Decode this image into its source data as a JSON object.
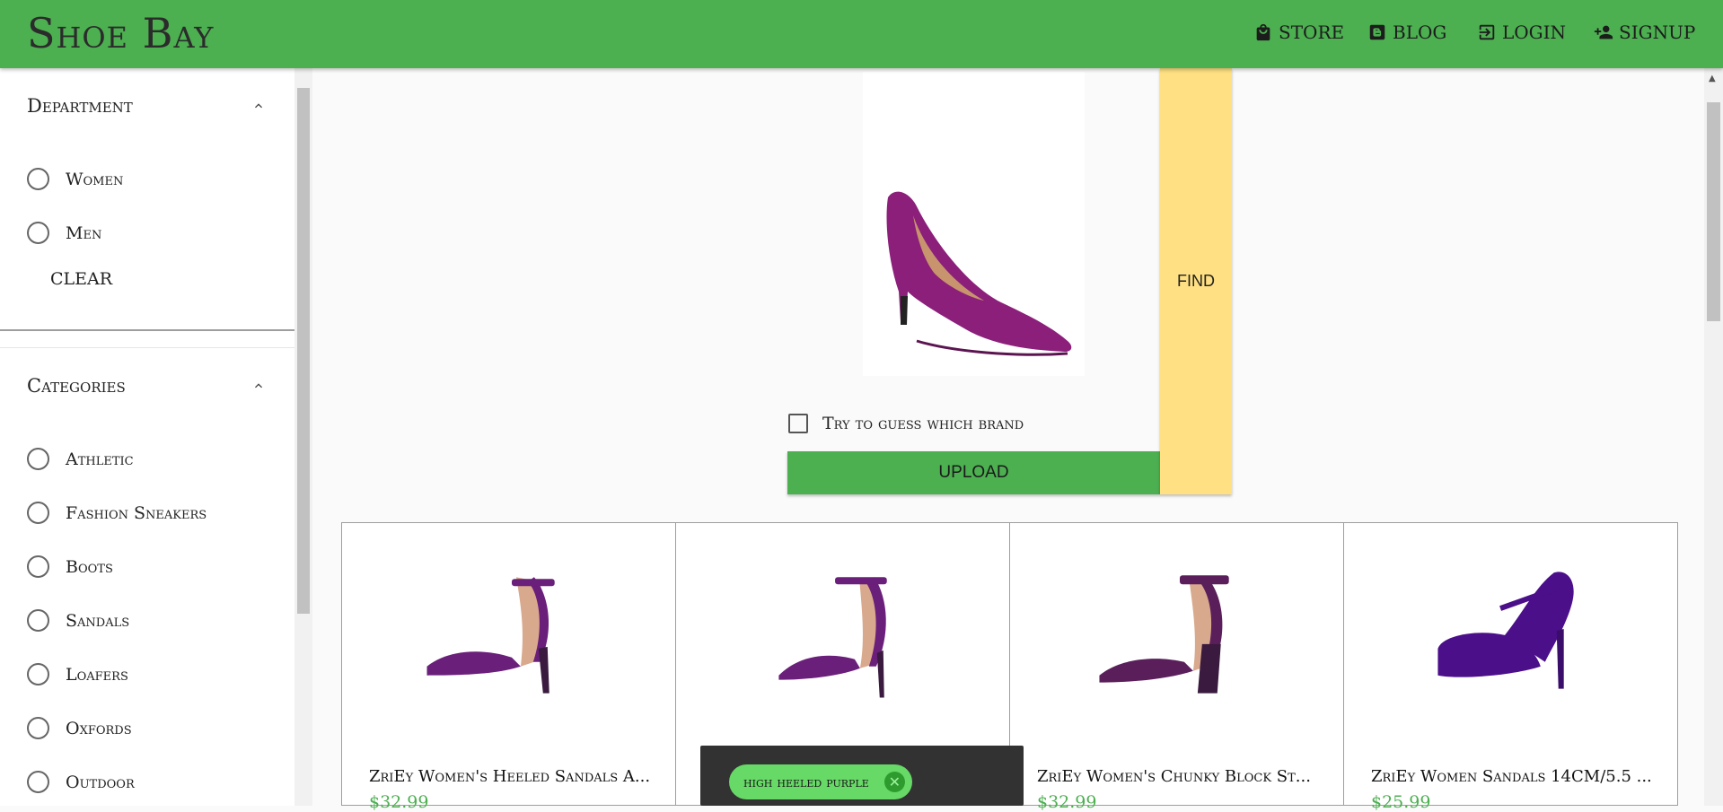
{
  "app": {
    "title": "Shoe Bay"
  },
  "nav": {
    "store": "STORE",
    "blog": "BLOG",
    "login": "LOGIN",
    "signup": "SIGNUP"
  },
  "sidebar": {
    "department": {
      "title": "Department",
      "options": [
        "Women",
        "Men"
      ],
      "clear": "CLEAR"
    },
    "categories": {
      "title": "Categories",
      "options": [
        "Athletic",
        "Fashion Sneakers",
        "Boots",
        "Sandals",
        "Loafers",
        "Oxfords",
        "Outdoor"
      ]
    }
  },
  "search": {
    "checkbox_label": "Try to guess which brand",
    "upload_label": "UPLOAD",
    "find_label": "FIND"
  },
  "products": [
    {
      "title": "ZriEy Women's Heeled Sandals A...",
      "price": "$32.99"
    },
    {
      "title": "",
      "price": ""
    },
    {
      "title": "ZriEy Women's Chunky Block St...",
      "price": "$32.99"
    },
    {
      "title": "ZriEy Women Sandals 14CM/5.5 ...",
      "price": "$25.99"
    }
  ],
  "snackbar": {
    "chip_label": "high heeled purple"
  },
  "colors": {
    "header": "#4caf50",
    "find": "#ffe082",
    "price": "#4caf50",
    "shoe": "#8b2a8f"
  }
}
